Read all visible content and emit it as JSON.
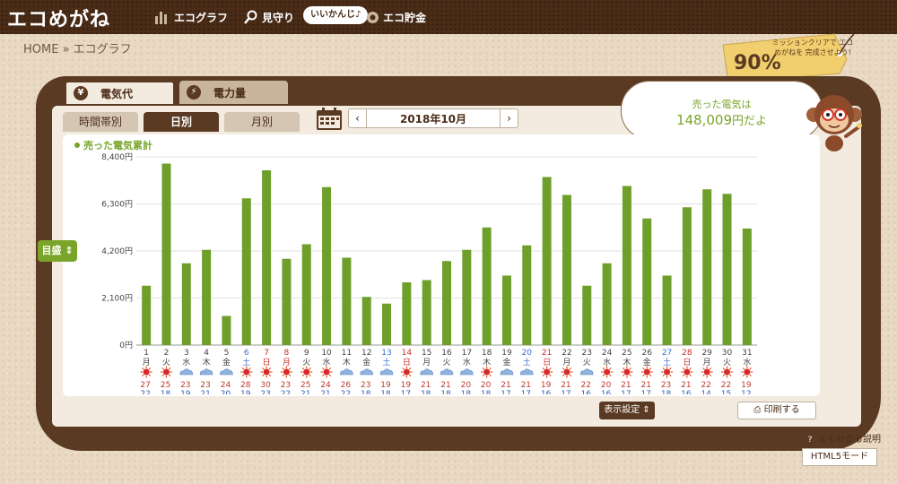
{
  "header": {
    "logo": "エコめがね",
    "nav": {
      "eco_graph": "エコグラフ",
      "mimamori": "見守り",
      "bubble": "いいかんじ♪",
      "eco_savings": "エコ貯金"
    }
  },
  "breadcrumb": "HOME » エコグラフ",
  "mission": {
    "percent": "90%",
    "text": "ミッションクリアで エコめがねを 完成させよう!"
  },
  "tabs": {
    "electricity": "電気代",
    "power": "電力量"
  },
  "period_tabs": {
    "hourly": "時間帯別",
    "daily": "日別",
    "monthly": "月別"
  },
  "date_nav": {
    "prev": "‹",
    "current": "2018年10月",
    "next": "›"
  },
  "sold": {
    "label": "売った電気は",
    "value": "148,009",
    "suffix": "円だよ"
  },
  "y_toggle": "目盛 ⇕",
  "chart_data": {
    "type": "bar",
    "title": "",
    "legend": "売った電気累計",
    "ylim": [
      0,
      8400
    ],
    "yticks": [
      "0円",
      "2,100円",
      "4,200円",
      "6,300円",
      "8,400円"
    ],
    "ytick_values": [
      0,
      2100,
      4200,
      6300,
      8400
    ],
    "categories": [
      "1",
      "2",
      "3",
      "4",
      "5",
      "6",
      "7",
      "8",
      "9",
      "10",
      "11",
      "12",
      "13",
      "14",
      "15",
      "16",
      "17",
      "18",
      "19",
      "20",
      "21",
      "22",
      "23",
      "24",
      "25",
      "26",
      "27",
      "28",
      "29",
      "30",
      "31"
    ],
    "weekdays": [
      "月",
      "火",
      "水",
      "木",
      "金",
      "土",
      "日",
      "月",
      "火",
      "水",
      "木",
      "金",
      "土",
      "日",
      "月",
      "火",
      "水",
      "木",
      "金",
      "土",
      "日",
      "月",
      "火",
      "水",
      "木",
      "金",
      "土",
      "日",
      "月",
      "火",
      "水"
    ],
    "day_colors": [
      "normal",
      "normal",
      "normal",
      "normal",
      "normal",
      "sat",
      "sun",
      "holiday",
      "normal",
      "normal",
      "normal",
      "normal",
      "sat",
      "sun",
      "normal",
      "normal",
      "normal",
      "normal",
      "normal",
      "sat",
      "sun",
      "normal",
      "normal",
      "normal",
      "normal",
      "normal",
      "sat",
      "sun",
      "normal",
      "normal",
      "normal"
    ],
    "values": [
      2650,
      8100,
      3650,
      4250,
      1300,
      6550,
      7800,
      3850,
      4500,
      7050,
      3900,
      2150,
      1850,
      2800,
      2900,
      3750,
      4250,
      5250,
      3100,
      4450,
      7500,
      6700,
      2650,
      3650,
      7100,
      5650,
      3100,
      6150,
      6950,
      6750,
      5200
    ],
    "weather": [
      "sun",
      "sun",
      "cloud",
      "cloud",
      "cloud",
      "sun",
      "sun",
      "sun",
      "sun",
      "sun",
      "cloud",
      "cloud",
      "cloud",
      "sun",
      "cloud",
      "cloud",
      "cloud",
      "sun",
      "cloud",
      "cloud",
      "sun",
      "sun",
      "cloud",
      "sun",
      "sun",
      "sun",
      "sun",
      "sun",
      "sun",
      "sun",
      "sun"
    ],
    "temp_high": [
      "27",
      "25",
      "23",
      "23",
      "24",
      "28",
      "30",
      "23",
      "25",
      "24",
      "26",
      "23",
      "19",
      "19",
      "21",
      "21",
      "20",
      "20",
      "21",
      "21",
      "19",
      "21",
      "22",
      "20",
      "21",
      "21",
      "23",
      "21",
      "22",
      "22",
      "19"
    ],
    "temp_low": [
      "22",
      "18",
      "19",
      "21",
      "20",
      "19",
      "23",
      "22",
      "21",
      "21",
      "22",
      "18",
      "18",
      "17",
      "18",
      "18",
      "18",
      "18",
      "17",
      "17",
      "16",
      "17",
      "16",
      "16",
      "17",
      "17",
      "18",
      "16",
      "14",
      "15",
      "12"
    ],
    "grid": true,
    "bar_color": "#6e9f2a"
  },
  "buttons": {
    "display_settings": "表示設定 ⇕",
    "print": "印刷する"
  },
  "help": "よくわかる説明",
  "html5": "HTML5モード",
  "colors": {
    "brown": "#4a2c17",
    "green": "#6e9f2a",
    "sat": "#3c6fd0",
    "sun": "#cc2a2a"
  }
}
